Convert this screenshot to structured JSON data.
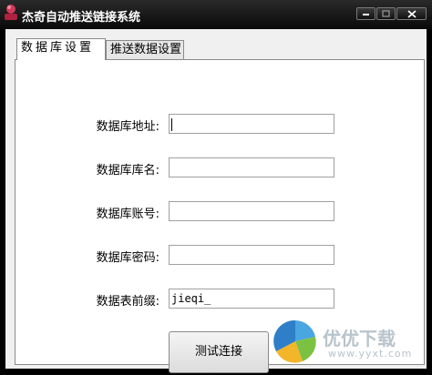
{
  "window": {
    "title": "杰奇自动推送链接系统",
    "icon": "app-logo-icon"
  },
  "title_buttons": {
    "minimize_icon": "minimize-icon",
    "maximize_icon": "maximize-icon",
    "close_icon": "close-icon"
  },
  "tabs": [
    {
      "label": "数据库设置",
      "active": true
    },
    {
      "label": "推送数据设置",
      "active": false
    }
  ],
  "form": {
    "fields": [
      {
        "label": "数据库地址:",
        "value": ""
      },
      {
        "label": "数据库库名:",
        "value": ""
      },
      {
        "label": "数据库账号:",
        "value": ""
      },
      {
        "label": "数据库密码:",
        "value": ""
      },
      {
        "label": "数据表前缀:",
        "value": "jieqi_"
      }
    ],
    "test_button_label": "测试连接"
  },
  "watermark": {
    "title": "优优下载",
    "url": "www.yyxt.com"
  },
  "colors": {
    "titlebar": "#000000",
    "client_bg": "#f0f0f0",
    "panel_bg": "#ffffff"
  }
}
